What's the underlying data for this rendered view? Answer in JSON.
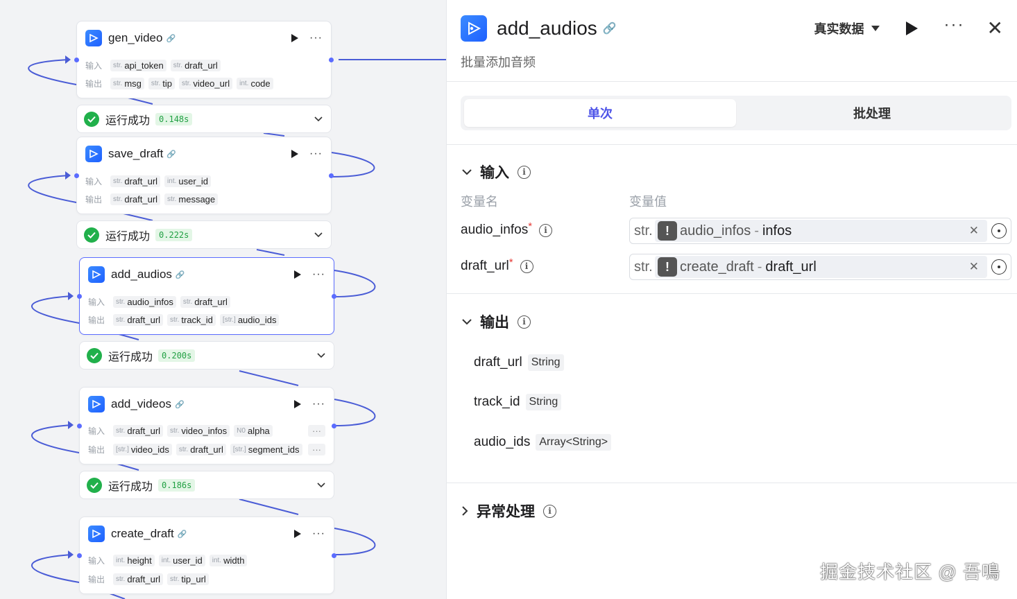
{
  "canvas": {
    "nodes": [
      {
        "title": "gen_video",
        "badge": "🔗",
        "inputs_label": "输入",
        "outputs_label": "输出",
        "inputs": [
          {
            "type": "str.",
            "name": "api_token"
          },
          {
            "type": "str.",
            "name": "draft_url"
          }
        ],
        "outputs": [
          {
            "type": "str.",
            "name": "msg"
          },
          {
            "type": "str.",
            "name": "tip"
          },
          {
            "type": "str.",
            "name": "video_url"
          },
          {
            "type": "int.",
            "name": "code"
          }
        ],
        "status": {
          "text": "运行成功",
          "time": "0.148s"
        }
      },
      {
        "title": "save_draft",
        "badge": "🔗",
        "inputs_label": "输入",
        "outputs_label": "输出",
        "inputs": [
          {
            "type": "str.",
            "name": "draft_url"
          },
          {
            "type": "int.",
            "name": "user_id"
          }
        ],
        "outputs": [
          {
            "type": "str.",
            "name": "draft_url"
          },
          {
            "type": "str.",
            "name": "message"
          }
        ],
        "status": {
          "text": "运行成功",
          "time": "0.222s"
        }
      },
      {
        "title": "add_audios",
        "badge": "🔗",
        "inputs_label": "输入",
        "outputs_label": "输出",
        "inputs": [
          {
            "type": "str.",
            "name": "audio_infos"
          },
          {
            "type": "str.",
            "name": "draft_url"
          }
        ],
        "outputs": [
          {
            "type": "str.",
            "name": "draft_url"
          },
          {
            "type": "str.",
            "name": "track_id"
          },
          {
            "type": "[str.]",
            "name": "audio_ids"
          }
        ],
        "status": {
          "text": "运行成功",
          "time": "0.200s"
        }
      },
      {
        "title": "add_videos",
        "badge": "🔗",
        "inputs_label": "输入",
        "outputs_label": "输出",
        "inputs": [
          {
            "type": "str.",
            "name": "draft_url"
          },
          {
            "type": "str.",
            "name": "video_infos"
          },
          {
            "type": "N0",
            "name": "alpha"
          }
        ],
        "outputs": [
          {
            "type": "[str.]",
            "name": "video_ids"
          },
          {
            "type": "str.",
            "name": "draft_url"
          },
          {
            "type": "[str.]",
            "name": "segment_ids"
          }
        ],
        "more": "···",
        "status": {
          "text": "运行成功",
          "time": "0.186s"
        }
      },
      {
        "title": "create_draft",
        "badge": "🔗",
        "inputs_label": "输入",
        "outputs_label": "输出",
        "inputs": [
          {
            "type": "int.",
            "name": "height"
          },
          {
            "type": "int.",
            "name": "user_id"
          },
          {
            "type": "int.",
            "name": "width"
          }
        ],
        "outputs": [
          {
            "type": "str.",
            "name": "draft_url"
          },
          {
            "type": "str.",
            "name": "tip_url"
          }
        ]
      }
    ]
  },
  "panel": {
    "title": "add_audios",
    "badge": "🔗",
    "subtitle": "批量添加音频",
    "data_source": "真实数据",
    "tabs": [
      {
        "label": "单次",
        "active": true
      },
      {
        "label": "批处理",
        "active": false
      }
    ],
    "input_section": {
      "title": "输入",
      "col_name": "变量名",
      "col_value": "变量值",
      "vars": [
        {
          "name": "audio_infos",
          "required": "*",
          "type": "str.",
          "ref_source": "audio_infos",
          "ref_sep": "-",
          "ref_field": "infos"
        },
        {
          "name": "draft_url",
          "required": "*",
          "type": "str.",
          "ref_source": "create_draft",
          "ref_sep": "-",
          "ref_field": "draft_url"
        }
      ]
    },
    "output_section": {
      "title": "输出",
      "vars": [
        {
          "name": "draft_url",
          "type": "String"
        },
        {
          "name": "track_id",
          "type": "String"
        },
        {
          "name": "audio_ids",
          "type": "Array<String>"
        }
      ]
    },
    "error_section": {
      "title": "异常处理"
    }
  },
  "watermark": "掘金技术社区 @ 吾鳴",
  "colors": {
    "accent": "#4d53e8",
    "port": "#5b6cff",
    "success": "#21b04b",
    "edge": "#4a5cd6"
  }
}
